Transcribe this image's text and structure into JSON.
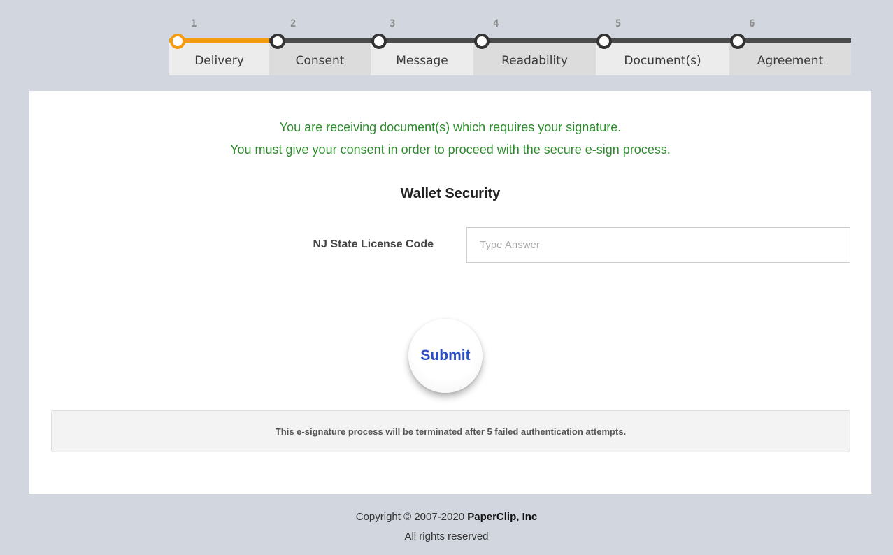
{
  "stepper": {
    "steps": [
      {
        "number": "1",
        "label": "Delivery",
        "state": "active"
      },
      {
        "number": "2",
        "label": "Consent",
        "state": "pending"
      },
      {
        "number": "3",
        "label": "Message",
        "state": "pending"
      },
      {
        "number": "4",
        "label": "Readability",
        "state": "pending"
      },
      {
        "number": "5",
        "label": "Document(s)",
        "state": "pending"
      },
      {
        "number": "6",
        "label": "Agreement",
        "state": "pending"
      }
    ]
  },
  "main": {
    "notice_line1": "You are receiving document(s) which requires your signature.",
    "notice_line2": "You must give your consent in order to proceed with the secure e-sign process.",
    "section_title": "Wallet Security",
    "field_label": "NJ State License Code",
    "field_placeholder": "Type Answer",
    "field_value": "",
    "submit_label": "Submit",
    "warning_text": "This e-signature process will be terminated after 5 failed authentication attempts."
  },
  "footer": {
    "copyright_prefix": "Copyright © 2007-2020",
    "company": "PaperClip, Inc",
    "rights": "All rights reserved"
  },
  "colors": {
    "page_background": "#d2d7df",
    "active_step": "#f39c12",
    "notice_text": "#2e8b2e",
    "submit_text": "#2b4fc4"
  }
}
